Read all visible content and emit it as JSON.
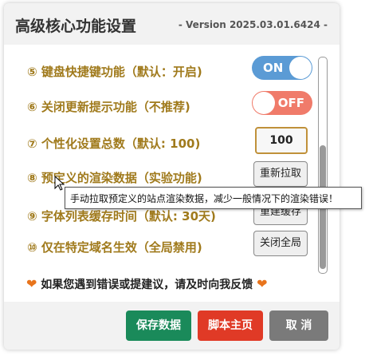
{
  "dialog": {
    "title": "高级核心功能设置",
    "version": "- Version 2025.03.01.6424 -"
  },
  "settings": [
    {
      "label": "⑤ 键盘快捷键功能（默认：开启)",
      "control": "toggle",
      "state": "ON"
    },
    {
      "label": "⑥ 关闭更新提示功能（不推荐)",
      "control": "toggle",
      "state": "OFF"
    },
    {
      "label": "⑦ 个性化设置总数（默认: 100)",
      "control": "number",
      "value": "100"
    },
    {
      "label": "⑧ 预定义的渲染数据（实验功能)",
      "control": "button",
      "button_label": "重新拉取"
    },
    {
      "label": "⑨ 字体列表缓存时间（默认: 30天)",
      "control": "button",
      "button_label": "重建缓存"
    },
    {
      "label": "⑩ 仅在特定域名生效（全局禁用)",
      "control": "button",
      "button_label": "关闭全局"
    }
  ],
  "feedback": {
    "heart": "❤",
    "text": "如果您遇到错误或提建议，请及时向我反馈"
  },
  "footer": {
    "save": "保存数据",
    "homepage": "脚本主页",
    "cancel": "取 消"
  },
  "tooltip": {
    "text": "手动拉取预定义的站点渲染数据，减少一般情况下的渲染错误！"
  },
  "colors": {
    "label": "#a07a1c",
    "toggle_on": "#5b9bd5",
    "toggle_off": "#f07b6a",
    "save_button": "#1a8a5a",
    "homepage_button": "#e03a26",
    "cancel_button": "#7a7a7a",
    "heart": "#e8741c"
  }
}
